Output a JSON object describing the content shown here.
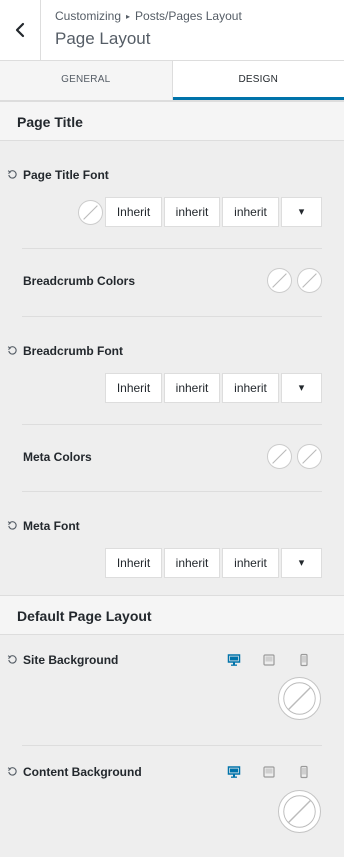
{
  "header": {
    "breadcrumb_root": "Customizing",
    "breadcrumb_sep": "▸",
    "breadcrumb_parent": "Posts/Pages Layout",
    "title": "Page Layout"
  },
  "tabs": [
    {
      "label": "GENERAL",
      "active": false
    },
    {
      "label": "DESIGN",
      "active": true
    }
  ],
  "sections": {
    "page_title": "Page Title",
    "default_page_layout": "Default Page Layout"
  },
  "controls": {
    "page_title_font": {
      "label": "Page Title Font",
      "family": "Inherit",
      "weight": "inherit",
      "style": "inherit",
      "more": "▾"
    },
    "breadcrumb_colors": {
      "label": "Breadcrumb Colors"
    },
    "breadcrumb_font": {
      "label": "Breadcrumb Font",
      "family": "Inherit",
      "weight": "inherit",
      "style": "inherit",
      "more": "▾"
    },
    "meta_colors": {
      "label": "Meta Colors"
    },
    "meta_font": {
      "label": "Meta Font",
      "family": "Inherit",
      "weight": "inherit",
      "style": "inherit",
      "more": "▾"
    },
    "site_background": {
      "label": "Site Background"
    },
    "content_background": {
      "label": "Content Background"
    }
  },
  "colors": {
    "accent": "#0073aa",
    "background": "#eeeeee",
    "section_bg": "#f5f5f5",
    "border": "#dddddd"
  },
  "icons": {
    "back": "chevron-left-icon",
    "reset": "reset-icon",
    "desktop": "desktop-icon",
    "tablet": "tablet-icon",
    "mobile": "mobile-icon"
  }
}
